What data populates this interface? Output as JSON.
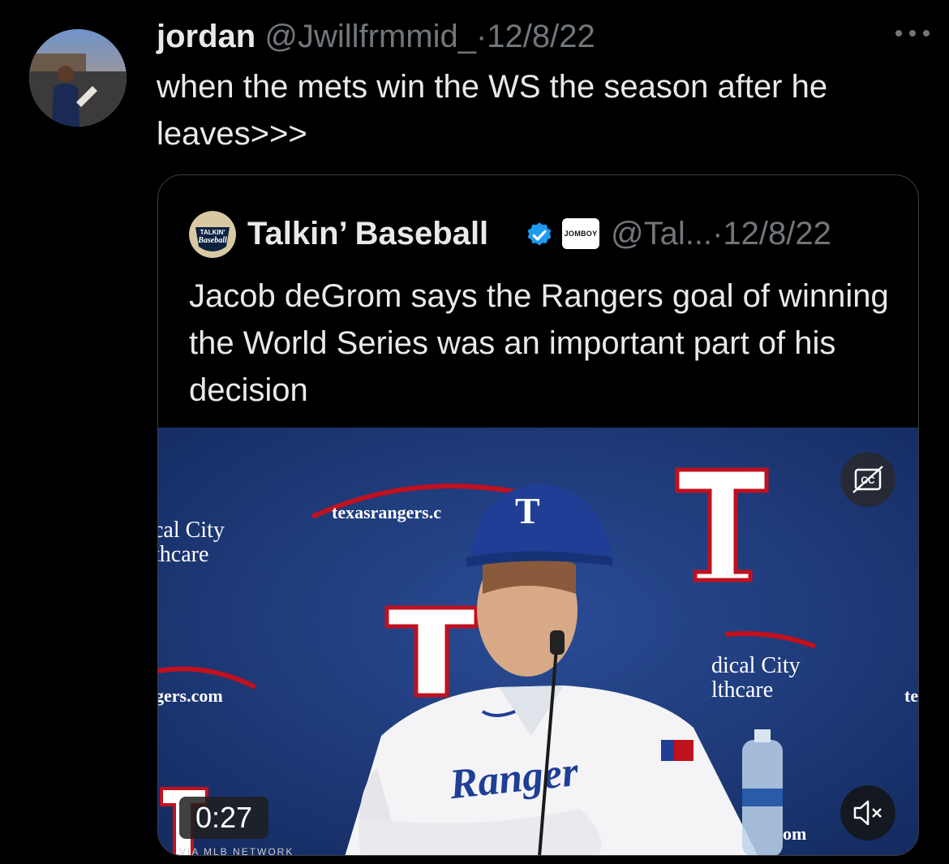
{
  "tweet": {
    "author_name": "jordan",
    "author_handle": "@Jwillfrmmid_",
    "separator": "·",
    "date": "12/8/22",
    "text": "when the mets win the WS the season after he leaves>>>"
  },
  "quoted_tweet": {
    "author_name": "Talkin’ Baseball",
    "affiliate_badge": "JOMBOY",
    "author_handle": "@Tal...",
    "separator": "·",
    "date": "12/8/22",
    "text": "Jacob deGrom says the Rangers goal of winning the World Series was an important part of his decision",
    "avatar_logo_lines": [
      "TALKIN'",
      "Baseball"
    ]
  },
  "video": {
    "duration": "0:27",
    "cc_icon": "closed-captions-off-icon",
    "mute_icon": "speaker-muted-icon",
    "backdrop_texts": {
      "left_sponsor_1": "cal City",
      "left_sponsor_2": "thcare",
      "left_site": "gers.com",
      "center_site": "texasrangers.c",
      "right_sponsor_1": "dical City",
      "right_sponsor_2": "lthcare",
      "right_site": "om",
      "right_edge": "te",
      "jersey": "Ranger",
      "watermark": "VIA MLB NETWORK"
    }
  },
  "colors": {
    "background": "#000000",
    "text": "#e7e9ea",
    "secondary_text": "#71767b",
    "verified": "#1d9bf0",
    "backdrop_blue": "#1e3a78",
    "rangers_red": "#c0111f"
  }
}
